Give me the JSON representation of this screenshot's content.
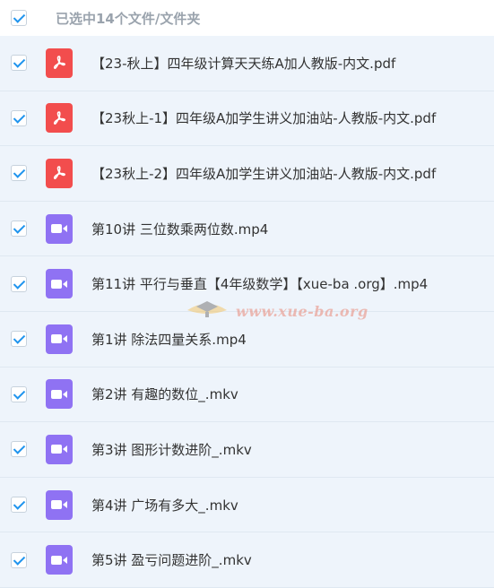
{
  "header": {
    "selection_label": "已选中14个文件/文件夹"
  },
  "files": [
    {
      "name": "【23-秋上】四年级计算天天练A加人教版-内文.pdf",
      "type": "pdf-icon"
    },
    {
      "name": "【23秋上-1】四年级A加学生讲义加油站-人教版-内文.pdf",
      "type": "pdf-icon"
    },
    {
      "name": "【23秋上-2】四年级A加学生讲义加油站-人教版-内文.pdf",
      "type": "pdf-icon"
    },
    {
      "name": "第10讲 三位数乘两位数.mp4",
      "type": "video-icon"
    },
    {
      "name": "第11讲 平行与垂直【4年级数学】【xue-ba .org】.mp4",
      "type": "video-icon"
    },
    {
      "name": "第1讲 除法四量关系.mp4",
      "type": "video-icon"
    },
    {
      "name": "第2讲 有趣的数位_.mkv",
      "type": "video-icon"
    },
    {
      "name": "第3讲 图形计数进阶_.mkv",
      "type": "video-icon"
    },
    {
      "name": "第4讲 广场有多大_.mkv",
      "type": "video-icon"
    },
    {
      "name": "第5讲 盈亏问题进阶_.mkv",
      "type": "video-icon"
    }
  ],
  "watermark": {
    "text": "www.xue-ba.org"
  },
  "colors": {
    "checkbox": "#1f94ee",
    "pdf": "#f24d4d",
    "video": "#8f72f3"
  }
}
